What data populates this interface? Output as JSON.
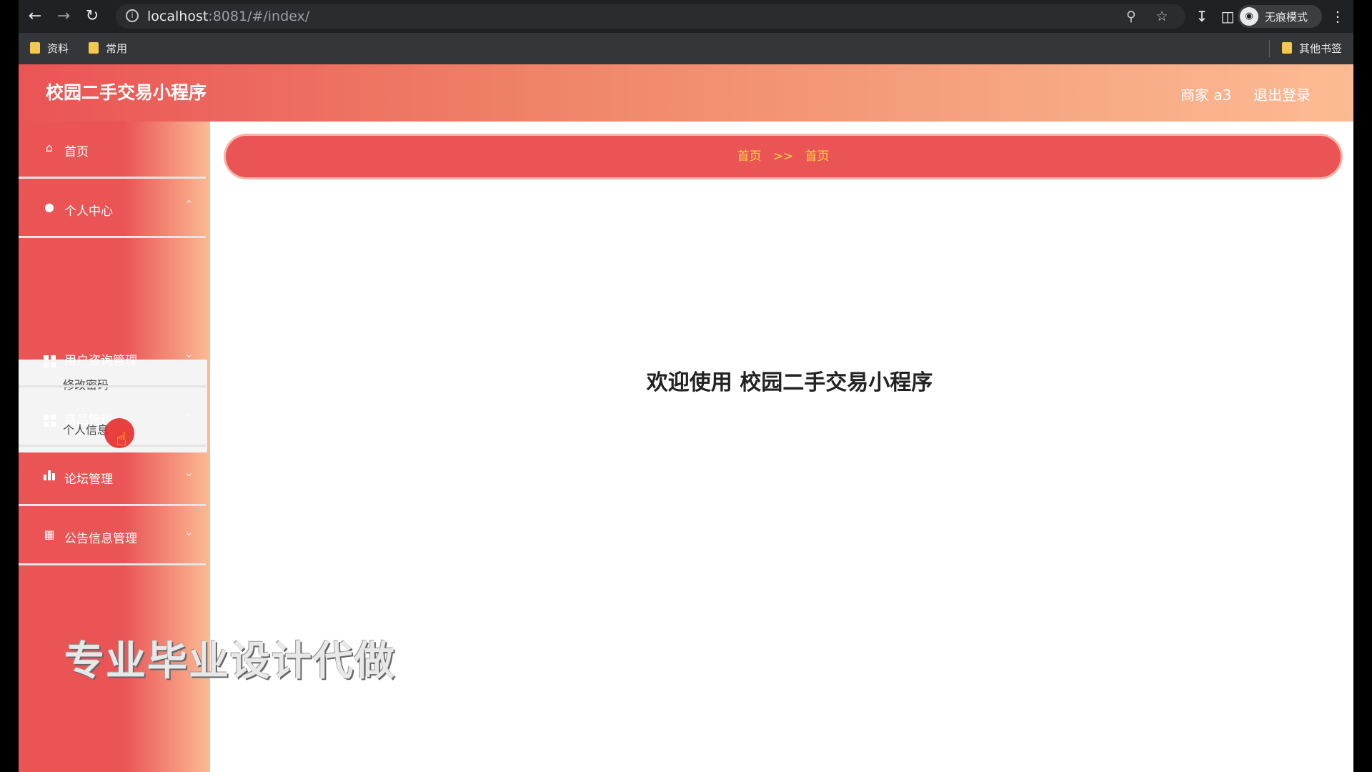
{
  "browser": {
    "url_host": "localhost",
    "url_rest": ":8081/#/index/",
    "incognito_label": "无痕模式",
    "bookmarks": [
      "资料",
      "常用"
    ],
    "other_bookmarks": "其他书签"
  },
  "header": {
    "title": "校园二手交易小程序",
    "user": "商家 a3",
    "logout": "退出登录"
  },
  "sidebar": {
    "items": [
      {
        "label": "首页",
        "icon": "home-icon"
      },
      {
        "label": "个人中心",
        "icon": "user-icon"
      },
      {
        "label": "用户咨询管理",
        "icon": "grid-icon"
      },
      {
        "label": "商品管理",
        "icon": "grid-icon"
      },
      {
        "label": "论坛管理",
        "icon": "bar-chart-icon"
      },
      {
        "label": "公告信息管理",
        "icon": "clipboard-icon"
      }
    ],
    "submenu": [
      "修改密码",
      "个人信息"
    ]
  },
  "breadcrumb": {
    "first": "首页",
    "separator": ">>",
    "second": "首页"
  },
  "main": {
    "welcome": "欢迎使用 校园二手交易小程序"
  },
  "watermark": "专业毕业设计代做",
  "colors": {
    "accent": "#ea5455",
    "gradient_end": "#fcbb94",
    "breadcrumb_text": "#ffd54a"
  }
}
